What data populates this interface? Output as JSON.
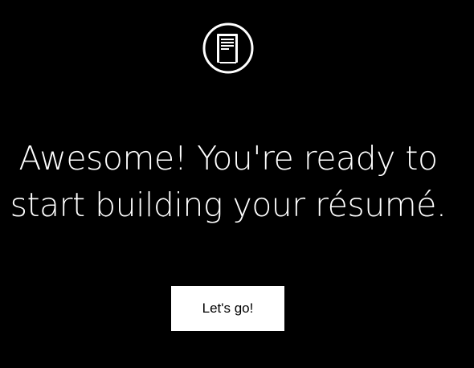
{
  "header": {
    "logo_icon": "resume-document-icon"
  },
  "main": {
    "headline_line1": "Awesome! You're ready to",
    "headline_line2": "start building your résumé.",
    "cta_label": "Let's go!"
  },
  "colors": {
    "background": "#000000",
    "text": "#ffffff",
    "button_background": "#ffffff",
    "button_text": "#000000"
  }
}
